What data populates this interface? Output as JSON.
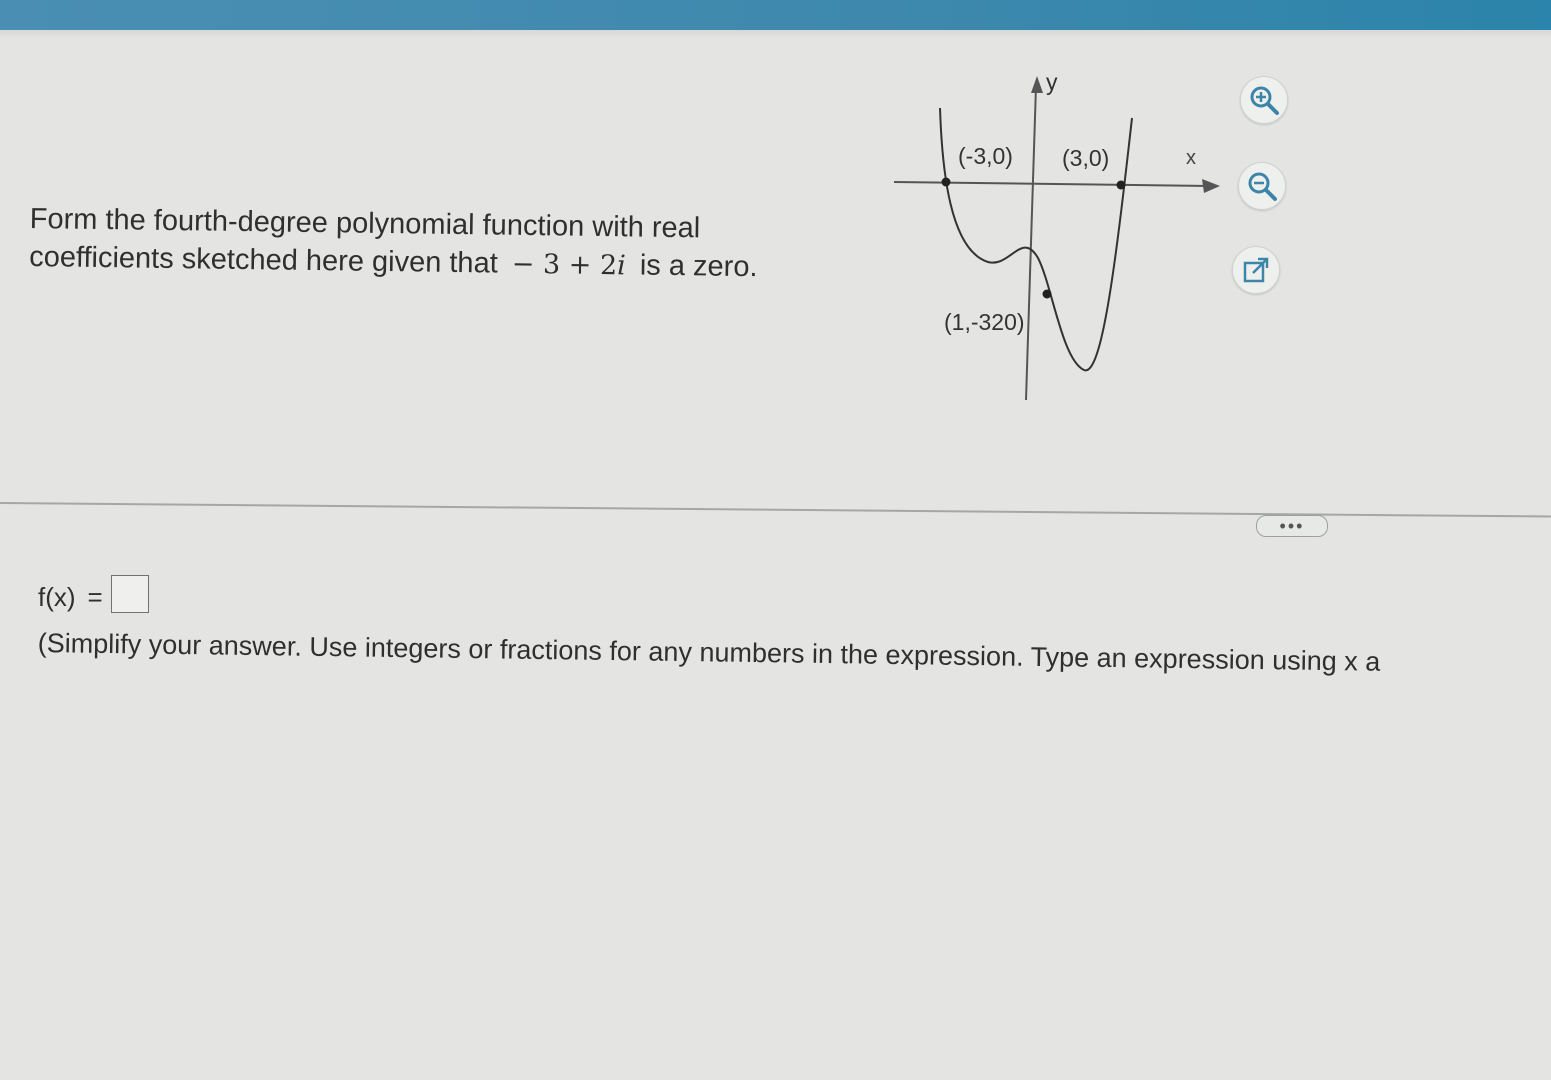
{
  "question": {
    "line1": "Form the fourth-degree polynomial function with real",
    "line2_prefix": "coefficients sketched here given that",
    "zero_real": "− 3 + 2",
    "zero_imag_unit": "i",
    "line2_suffix": "is a zero."
  },
  "graph": {
    "y_axis_label": "y",
    "x_axis_label": "x",
    "point_a_label": "(-3,0)",
    "point_b_label": "(3,0)",
    "point_c_label": "(1,-320)"
  },
  "tools": {
    "zoom_in": "zoom-in-icon",
    "zoom_out": "zoom-out-icon",
    "popout": "external-link-icon"
  },
  "more_button_label": "•••",
  "answer": {
    "lhs": "f(x)",
    "equals": "=",
    "value": ""
  },
  "instruction": "(Simplify your answer. Use integers or fractions for any numbers in the expression. Type an expression using x a",
  "colors": {
    "accent": "#3d88ad",
    "background": "#e4e5e3",
    "text": "#2f2f2f"
  }
}
